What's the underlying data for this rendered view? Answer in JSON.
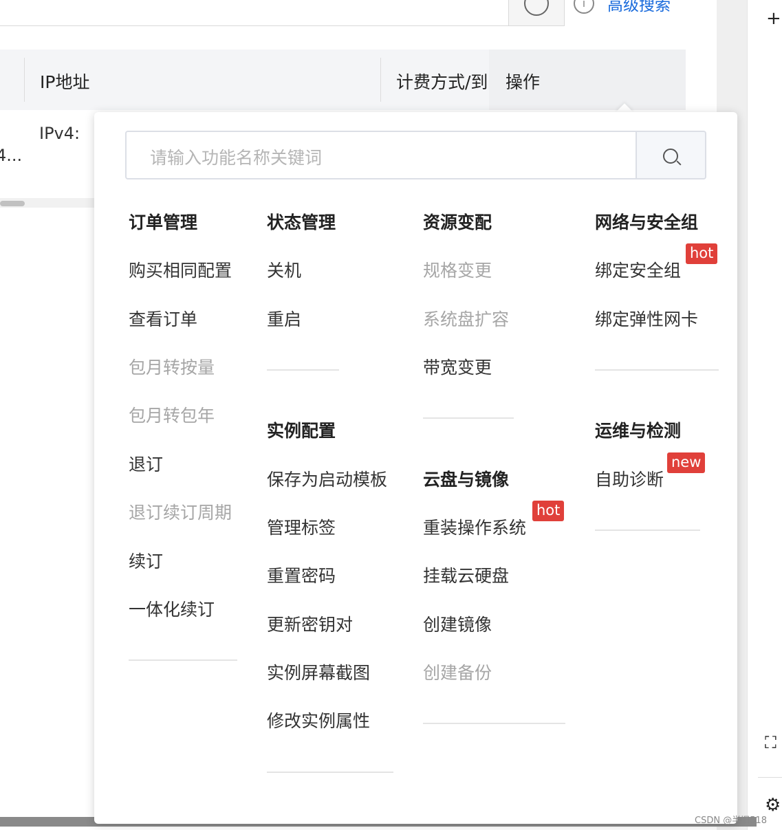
{
  "page": {
    "advanced_search": "高级搜索",
    "table_headers": [
      "IP地址",
      "计费方式/到",
      "操作"
    ],
    "row_ip_label": "IPv4:",
    "row_truncated": "4..."
  },
  "panel": {
    "search_placeholder": "请输入功能名称关键词",
    "groups": [
      {
        "title": "订单管理",
        "items": [
          "购买相同配置",
          "查看订单",
          "包月转按量",
          "包月转包年",
          "退订",
          "退订续订周期",
          "续订",
          "一体化续订"
        ]
      },
      {
        "title": "状态管理",
        "items": [
          "关机",
          "重启"
        ]
      },
      {
        "title": "实例配置",
        "items": [
          "保存为启动模板",
          "管理标签",
          "重置密码",
          "更新密钥对",
          "实例屏幕截图",
          "修改实例属性"
        ]
      },
      {
        "title": "资源变配",
        "items": [
          "规格变更",
          "系统盘扩容",
          "带宽变更"
        ]
      },
      {
        "title": "云盘与镜像",
        "items": [
          "重装操作系统",
          "挂载云硬盘",
          "创建镜像",
          "创建备份"
        ]
      },
      {
        "title": "网络与安全组",
        "items": [
          "绑定安全组",
          "绑定弹性网卡"
        ]
      },
      {
        "title": "运维与检测",
        "items": [
          "自助诊断"
        ]
      }
    ],
    "badges": {
      "hot": "hot",
      "new": "new"
    },
    "colors": {
      "badge": "#e0403a",
      "disabled": "#a6a6a6",
      "link": "#1a6bdc"
    }
  },
  "watermark": "CSDN @半旧518"
}
